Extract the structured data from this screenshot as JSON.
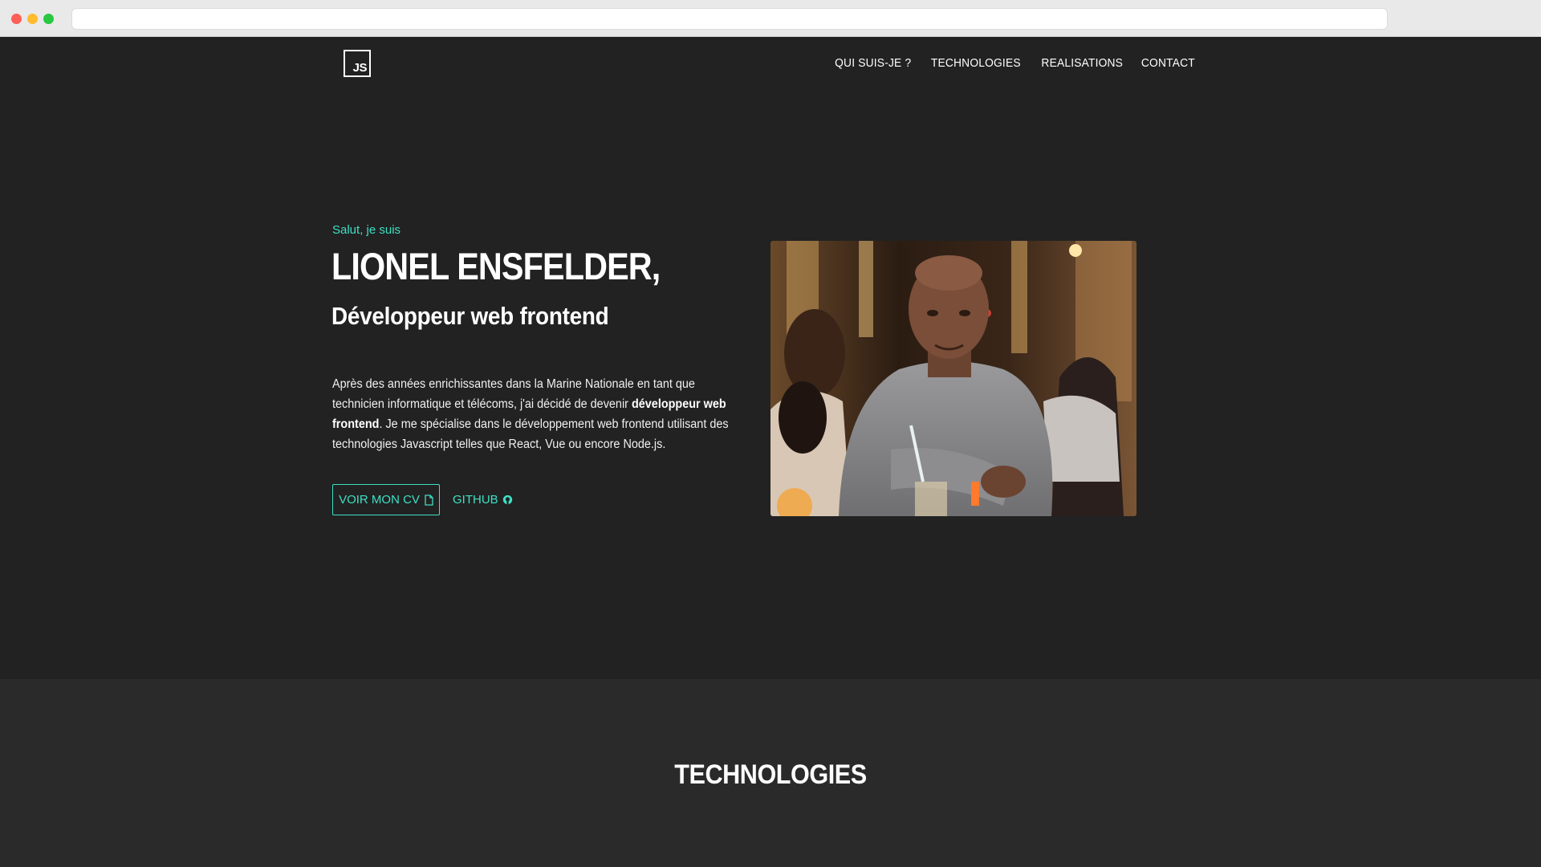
{
  "nav": {
    "logo_text": "JS",
    "items": [
      "QUI SUIS-JE ?",
      "TECHNOLOGIES",
      "REALISATIONS",
      "CONTACT"
    ]
  },
  "hero": {
    "greeting": "Salut, je suis",
    "name": "LIONEL ENSFELDER,",
    "role": "Développeur web frontend",
    "bio_before": "Après des années enrichissantes dans la Marine Nationale en tant que technicien informatique et télécoms, j'ai décidé de devenir ",
    "bio_bold": "développeur web frontend",
    "bio_after": ". Je me spécialise dans le développement web frontend utilisant des technologies Javascript telles que React, Vue ou encore Node.js.",
    "cv_button": "VOIR MON CV",
    "github_button": "GITHUB",
    "cv_icon": "file-icon",
    "github_icon": "github-icon"
  },
  "technologies": {
    "title": "TECHNOLOGIES"
  },
  "colors": {
    "accent": "#3de0c3",
    "background": "#222222",
    "section_background": "#2a2a2a"
  }
}
